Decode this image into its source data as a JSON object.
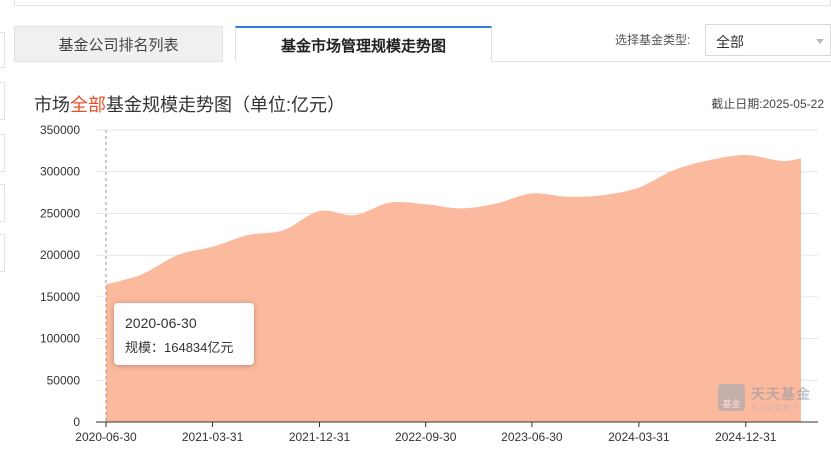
{
  "tabs": [
    {
      "label": "基金公司排名列表",
      "active": false
    },
    {
      "label": "基金市场管理规模走势图",
      "active": true
    }
  ],
  "filter": {
    "label": "选择基金类型:",
    "value": "全部"
  },
  "title": {
    "prefix": "市场",
    "highlight": "全部",
    "suffix": "基金规模走势图（单位:亿元）"
  },
  "cutoff_date": "截止日期:2025-05-22",
  "tooltip": {
    "date": "2020-06-30",
    "value_text": "规模：164834亿元"
  },
  "watermark": {
    "badge": "基金",
    "brand": "天天基金",
    "tagline": "东方财富旗下"
  },
  "colors": {
    "area": "#fbb99e",
    "highlight": "#e8502a",
    "tab_accent": "#2f7ee0"
  },
  "chart_data": {
    "type": "area",
    "unit": "亿元",
    "ylim": [
      0,
      350000
    ],
    "yticks": [
      0,
      50000,
      100000,
      150000,
      200000,
      250000,
      300000,
      350000
    ],
    "xticks": [
      "2020-06-30",
      "2021-03-31",
      "2021-12-31",
      "2022-09-30",
      "2023-06-30",
      "2024-03-31",
      "2024-12-31"
    ],
    "grid": true,
    "series": [
      {
        "x": [
          "2020-06-30",
          "2020-09-30",
          "2020-12-31",
          "2021-03-31",
          "2021-06-30",
          "2021-09-30",
          "2021-12-31",
          "2022-03-31",
          "2022-06-30",
          "2022-09-30",
          "2022-12-31",
          "2023-03-31",
          "2023-06-30",
          "2023-09-30",
          "2023-12-31",
          "2024-03-31",
          "2024-06-30",
          "2024-09-30",
          "2024-12-31",
          "2025-03-31",
          "2025-05-22"
        ],
        "values": [
          164834,
          177000,
          200000,
          210000,
          224000,
          230000,
          253000,
          248000,
          263000,
          261000,
          256000,
          262000,
          274000,
          270000,
          272000,
          281000,
          302000,
          314000,
          320000,
          313000,
          316000
        ]
      }
    ]
  }
}
